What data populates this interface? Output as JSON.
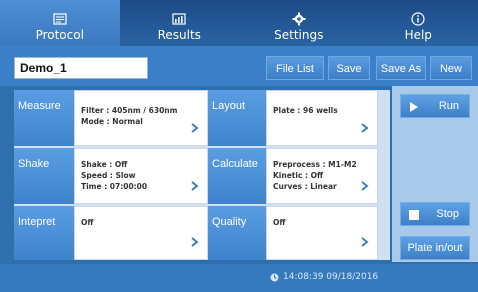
{
  "nav": {
    "tabs": [
      {
        "label": "Protocol",
        "icon": "protocol-icon",
        "active": true
      },
      {
        "label": "Results",
        "icon": "results-icon",
        "active": false
      },
      {
        "label": "Settings",
        "icon": "gear-icon",
        "active": false
      },
      {
        "label": "Help",
        "icon": "info-icon",
        "active": false
      }
    ]
  },
  "toolbar": {
    "name_value": "Demo_1",
    "file_list": "File List",
    "save": "Save",
    "save_as": "Save As",
    "new": "New"
  },
  "grid": {
    "measure": {
      "label": "Measure",
      "lines": [
        "Filter :  405nm / 630nm",
        "Mode :  Normal"
      ]
    },
    "layout": {
      "label": "Layout",
      "lines": [
        "Plate :  96 wells"
      ]
    },
    "shake": {
      "label": "Shake",
      "lines": [
        "Shake :  Off",
        "Speed :  Slow",
        "Time :   07:00:00"
      ]
    },
    "calculate": {
      "label": "Calculate",
      "lines": [
        "Preprocess :  M1-M2",
        "Kinetic :  Off",
        "Curves :  Linear"
      ]
    },
    "intepret": {
      "label": "Intepret",
      "lines": [
        "Off"
      ]
    },
    "quality": {
      "label": "Quality",
      "lines": [
        "Off"
      ]
    }
  },
  "actions": {
    "run": "Run",
    "stop": "Stop",
    "plate": "Plate in/out"
  },
  "status": {
    "datetime": "14:08:39  09/18/2016"
  },
  "colors": {
    "nav_bg": "#1d4b86",
    "accent": "#3b7fc8",
    "label_blue": "#4a8fd8"
  }
}
